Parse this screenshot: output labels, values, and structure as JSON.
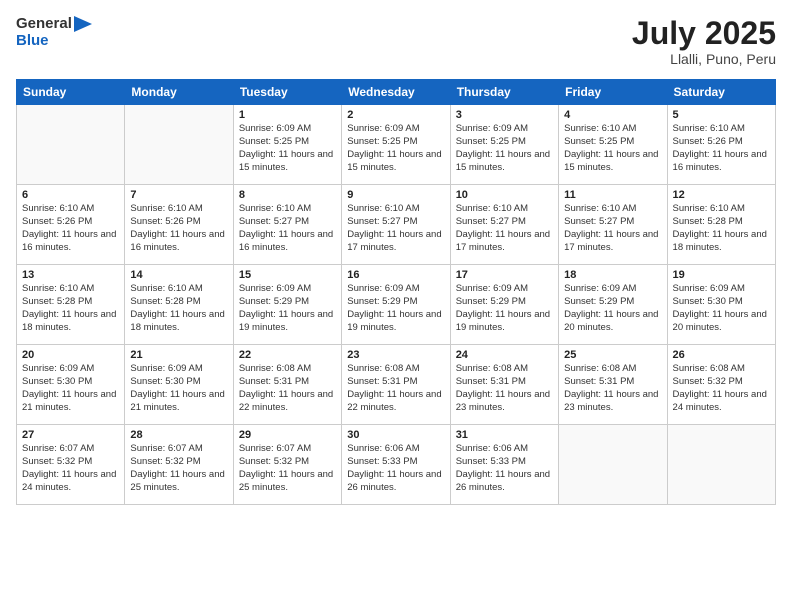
{
  "header": {
    "logo_general": "General",
    "logo_blue": "Blue",
    "month_title": "July 2025",
    "location": "Llalli, Puno, Peru"
  },
  "days_of_week": [
    "Sunday",
    "Monday",
    "Tuesday",
    "Wednesday",
    "Thursday",
    "Friday",
    "Saturday"
  ],
  "weeks": [
    [
      {
        "day": "",
        "info": ""
      },
      {
        "day": "",
        "info": ""
      },
      {
        "day": "1",
        "info": "Sunrise: 6:09 AM\nSunset: 5:25 PM\nDaylight: 11 hours and 15 minutes."
      },
      {
        "day": "2",
        "info": "Sunrise: 6:09 AM\nSunset: 5:25 PM\nDaylight: 11 hours and 15 minutes."
      },
      {
        "day": "3",
        "info": "Sunrise: 6:09 AM\nSunset: 5:25 PM\nDaylight: 11 hours and 15 minutes."
      },
      {
        "day": "4",
        "info": "Sunrise: 6:10 AM\nSunset: 5:25 PM\nDaylight: 11 hours and 15 minutes."
      },
      {
        "day": "5",
        "info": "Sunrise: 6:10 AM\nSunset: 5:26 PM\nDaylight: 11 hours and 16 minutes."
      }
    ],
    [
      {
        "day": "6",
        "info": "Sunrise: 6:10 AM\nSunset: 5:26 PM\nDaylight: 11 hours and 16 minutes."
      },
      {
        "day": "7",
        "info": "Sunrise: 6:10 AM\nSunset: 5:26 PM\nDaylight: 11 hours and 16 minutes."
      },
      {
        "day": "8",
        "info": "Sunrise: 6:10 AM\nSunset: 5:27 PM\nDaylight: 11 hours and 16 minutes."
      },
      {
        "day": "9",
        "info": "Sunrise: 6:10 AM\nSunset: 5:27 PM\nDaylight: 11 hours and 17 minutes."
      },
      {
        "day": "10",
        "info": "Sunrise: 6:10 AM\nSunset: 5:27 PM\nDaylight: 11 hours and 17 minutes."
      },
      {
        "day": "11",
        "info": "Sunrise: 6:10 AM\nSunset: 5:27 PM\nDaylight: 11 hours and 17 minutes."
      },
      {
        "day": "12",
        "info": "Sunrise: 6:10 AM\nSunset: 5:28 PM\nDaylight: 11 hours and 18 minutes."
      }
    ],
    [
      {
        "day": "13",
        "info": "Sunrise: 6:10 AM\nSunset: 5:28 PM\nDaylight: 11 hours and 18 minutes."
      },
      {
        "day": "14",
        "info": "Sunrise: 6:10 AM\nSunset: 5:28 PM\nDaylight: 11 hours and 18 minutes."
      },
      {
        "day": "15",
        "info": "Sunrise: 6:09 AM\nSunset: 5:29 PM\nDaylight: 11 hours and 19 minutes."
      },
      {
        "day": "16",
        "info": "Sunrise: 6:09 AM\nSunset: 5:29 PM\nDaylight: 11 hours and 19 minutes."
      },
      {
        "day": "17",
        "info": "Sunrise: 6:09 AM\nSunset: 5:29 PM\nDaylight: 11 hours and 19 minutes."
      },
      {
        "day": "18",
        "info": "Sunrise: 6:09 AM\nSunset: 5:29 PM\nDaylight: 11 hours and 20 minutes."
      },
      {
        "day": "19",
        "info": "Sunrise: 6:09 AM\nSunset: 5:30 PM\nDaylight: 11 hours and 20 minutes."
      }
    ],
    [
      {
        "day": "20",
        "info": "Sunrise: 6:09 AM\nSunset: 5:30 PM\nDaylight: 11 hours and 21 minutes."
      },
      {
        "day": "21",
        "info": "Sunrise: 6:09 AM\nSunset: 5:30 PM\nDaylight: 11 hours and 21 minutes."
      },
      {
        "day": "22",
        "info": "Sunrise: 6:08 AM\nSunset: 5:31 PM\nDaylight: 11 hours and 22 minutes."
      },
      {
        "day": "23",
        "info": "Sunrise: 6:08 AM\nSunset: 5:31 PM\nDaylight: 11 hours and 22 minutes."
      },
      {
        "day": "24",
        "info": "Sunrise: 6:08 AM\nSunset: 5:31 PM\nDaylight: 11 hours and 23 minutes."
      },
      {
        "day": "25",
        "info": "Sunrise: 6:08 AM\nSunset: 5:31 PM\nDaylight: 11 hours and 23 minutes."
      },
      {
        "day": "26",
        "info": "Sunrise: 6:08 AM\nSunset: 5:32 PM\nDaylight: 11 hours and 24 minutes."
      }
    ],
    [
      {
        "day": "27",
        "info": "Sunrise: 6:07 AM\nSunset: 5:32 PM\nDaylight: 11 hours and 24 minutes."
      },
      {
        "day": "28",
        "info": "Sunrise: 6:07 AM\nSunset: 5:32 PM\nDaylight: 11 hours and 25 minutes."
      },
      {
        "day": "29",
        "info": "Sunrise: 6:07 AM\nSunset: 5:32 PM\nDaylight: 11 hours and 25 minutes."
      },
      {
        "day": "30",
        "info": "Sunrise: 6:06 AM\nSunset: 5:33 PM\nDaylight: 11 hours and 26 minutes."
      },
      {
        "day": "31",
        "info": "Sunrise: 6:06 AM\nSunset: 5:33 PM\nDaylight: 11 hours and 26 minutes."
      },
      {
        "day": "",
        "info": ""
      },
      {
        "day": "",
        "info": ""
      }
    ]
  ]
}
